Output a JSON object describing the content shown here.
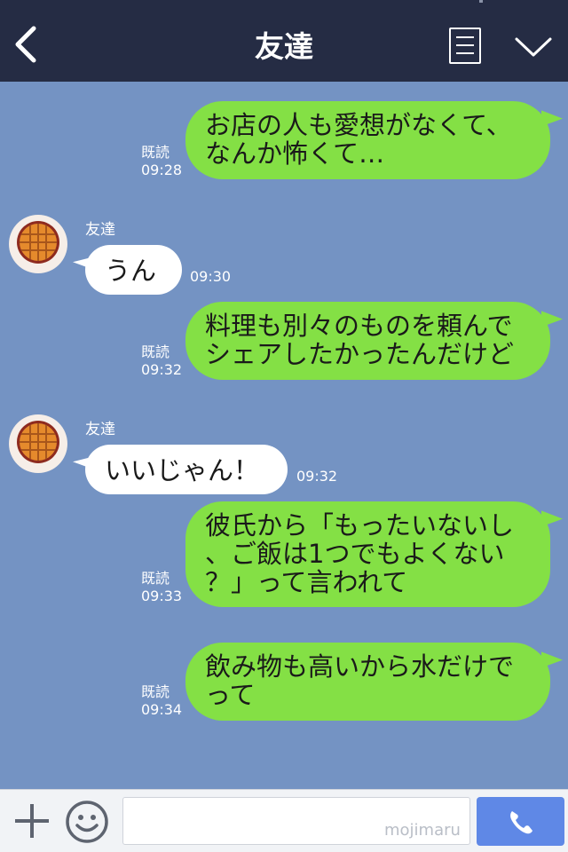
{
  "header": {
    "title": "友達",
    "back_icon": "chevron-left-icon",
    "memo_icon": "note-icon",
    "menu_icon": "chevron-down-icon"
  },
  "messages": [
    {
      "side": "right",
      "text": "お店の人も愛想がなくて、\nなんか怖くて…",
      "read": "既読",
      "time": "09:28"
    },
    {
      "side": "left",
      "sender": "友達",
      "text": "うん",
      "time": "09:30"
    },
    {
      "side": "right",
      "text": "料理も別々のものを頼んで\nシェアしたかったんだけど",
      "read": "既読",
      "time": "09:32"
    },
    {
      "side": "left",
      "sender": "友達",
      "text": "いいじゃん！",
      "time": "09:32"
    },
    {
      "side": "right",
      "text": "彼氏から「もったいないし\n、ご飯は1つでもよくない\n？」って言われて",
      "read": "既読",
      "time": "09:33"
    },
    {
      "side": "right",
      "text": "飲み物も高いから水だけで\nって",
      "read": "既読",
      "time": "09:34"
    }
  ],
  "footer": {
    "input_value": "",
    "watermark": "mojimaru",
    "plus_icon": "plus-icon",
    "emoji_icon": "smiley-icon",
    "call_icon": "phone-icon"
  },
  "colors": {
    "header_bg": "#252c44",
    "chat_bg": "#7493c3",
    "outgoing_bubble": "#84e045",
    "incoming_bubble": "#ffffff",
    "call_button": "#5f88e6"
  }
}
